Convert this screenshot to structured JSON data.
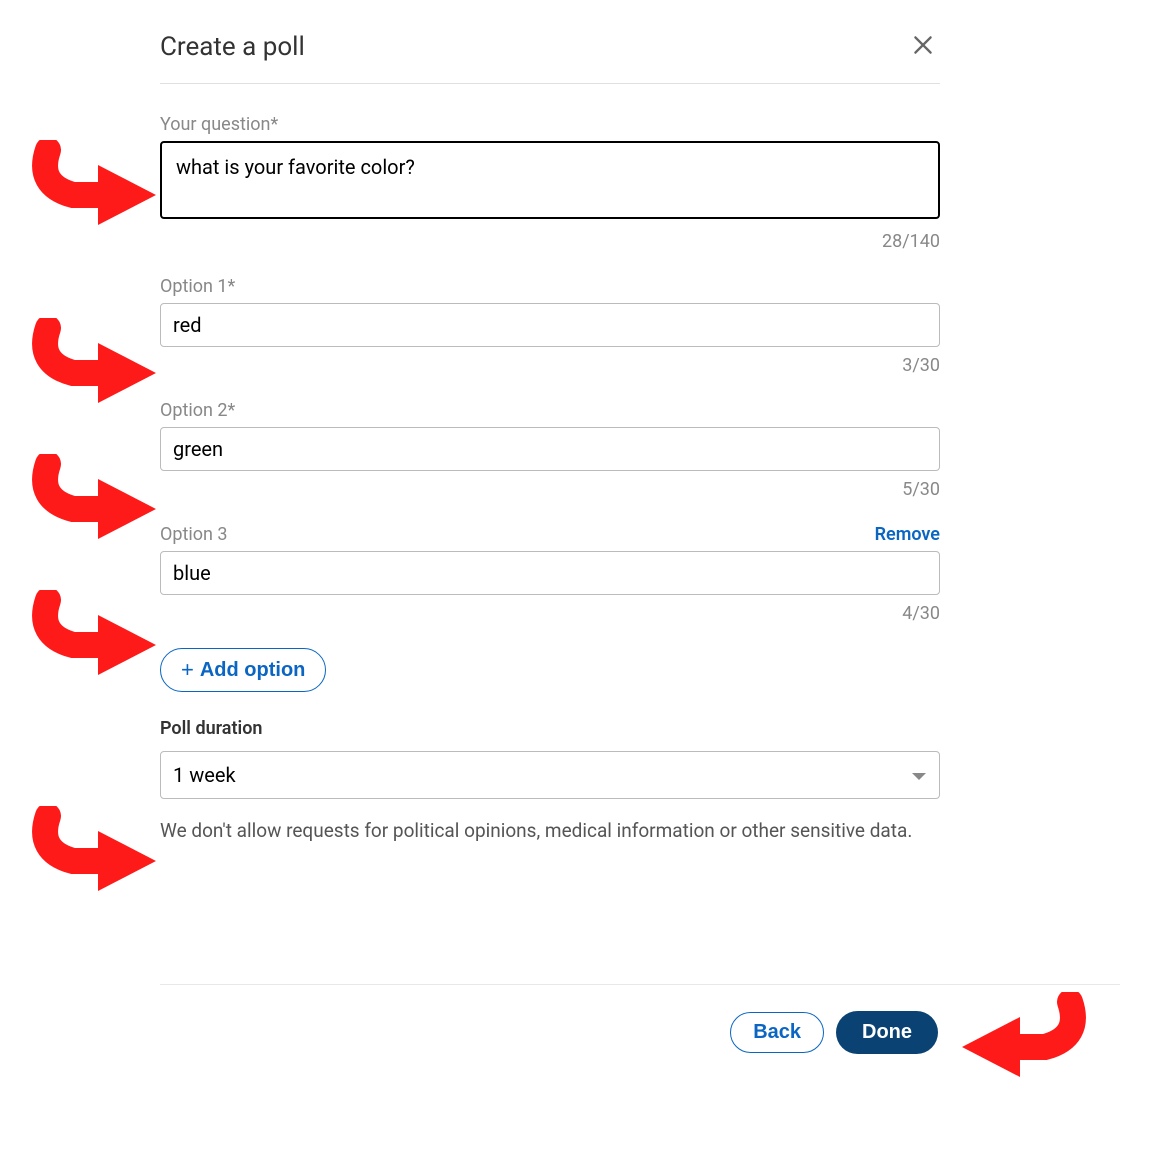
{
  "modal": {
    "title": "Create a poll"
  },
  "question": {
    "label": "Your question*",
    "value": "what is your favorite color?",
    "counter": "28/140"
  },
  "options": [
    {
      "label": "Option 1*",
      "value": "red",
      "counter": "3/30",
      "removable": false
    },
    {
      "label": "Option 2*",
      "value": "green",
      "counter": "5/30",
      "removable": false
    },
    {
      "label": "Option 3",
      "value": "blue",
      "counter": "4/30",
      "removable": true
    }
  ],
  "remove_label": "Remove",
  "add_option_label": "Add option",
  "duration": {
    "label": "Poll duration",
    "value": "1 week"
  },
  "disclaimer": "We don't allow requests for political opinions, medical information or other sensitive data.",
  "footer": {
    "back": "Back",
    "done": "Done"
  }
}
